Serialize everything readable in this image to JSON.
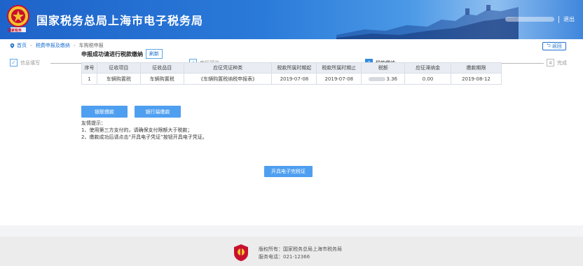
{
  "header": {
    "emblem_text": "国家税务",
    "site_title": "国家税务总局上海市电子税务局",
    "logout_label": "退出"
  },
  "breadcrumb": {
    "home": "首页",
    "level1": "税费申报及缴纳",
    "current": "车购税申报",
    "back_label": "返回"
  },
  "steps": [
    {
      "icon": "check-icon",
      "label": "信息填写",
      "state": "done"
    },
    {
      "icon": "check-icon",
      "label": "申报预览",
      "state": "done"
    },
    {
      "number": "3",
      "label": "税款缴纳",
      "state": "active"
    },
    {
      "number": "4",
      "label": "完成",
      "state": "todo"
    }
  ],
  "payment": {
    "section_title": "申报成功请进行税款缴纳",
    "refresh_label": "刷新",
    "columns": [
      "序号",
      "征收项目",
      "征收品目",
      "应征凭证种类",
      "税款所属时期起",
      "税款所属时期止",
      "税额",
      "应征滞纳金",
      "缴款期限"
    ],
    "rows": [
      [
        "1",
        "车辆购置税",
        "车辆购置税",
        "《车辆购置税纳税申报表》",
        "2019-07-08",
        "2019-07-08",
        "3.36",
        "0.00",
        "2019-08-12"
      ]
    ]
  },
  "buttons": {
    "union_pay": "银联缴款",
    "bank_debit": "银行端缴款",
    "issue_certificate": "开具电子完税证"
  },
  "tips": {
    "title": "友情提示：",
    "lines": [
      "1、使用第三方支付的，请确保支付限额大于税款；",
      "2、缴款成功后请点击“开具电子凭证”按钮开具电子凭证。"
    ]
  },
  "footer": {
    "copyright": "版权所有：国家税务总局上海市税务局",
    "phone": "服务电话：021-12366"
  },
  "colors": {
    "brand_blue": "#1a6fd1",
    "button_blue": "#4f9ff0",
    "header_blue": "#1e63c9"
  }
}
